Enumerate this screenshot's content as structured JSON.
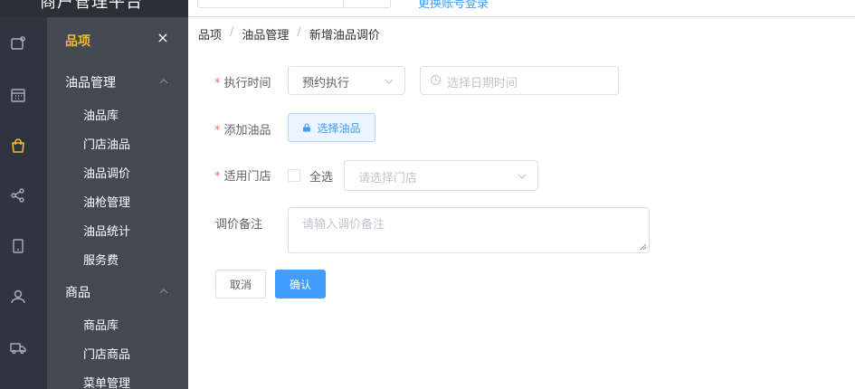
{
  "header": {
    "brand": "商户管理平台",
    "link": "更换账号登录"
  },
  "rail": {
    "icons": [
      "coupon-icon",
      "calendar-icon",
      "shopping-bag-icon",
      "share-icon",
      "tablet-icon",
      "user-icon",
      "truck-icon"
    ],
    "active_color": "#f7ba2a"
  },
  "menu": {
    "title": "品项",
    "close": "×",
    "groups": [
      {
        "label": "油品管理",
        "items": [
          "油品库",
          "门店油品",
          "油品调价",
          "油枪管理",
          "油品统计",
          "服务费"
        ]
      },
      {
        "label": "商品",
        "items": [
          "商品库",
          "门店商品",
          "菜单管理"
        ]
      }
    ]
  },
  "breadcrumb": {
    "items": [
      "品项",
      "油品管理",
      "新增油品调价"
    ],
    "sep": "/"
  },
  "form": {
    "required_mark": "*",
    "exec_time": {
      "label": "执行时间",
      "mode_value": "预约执行",
      "date_placeholder": "选择日期时间"
    },
    "add_oil": {
      "label": "添加油品",
      "button": "选择油品"
    },
    "stores": {
      "label": "适用门店",
      "select_all": "全选",
      "placeholder": "请选择门店"
    },
    "remark": {
      "label": "调价备注",
      "placeholder": "请输入调价备注"
    },
    "cancel": "取消",
    "confirm": "确认"
  },
  "colors": {
    "primary": "#409eff",
    "danger": "#f56c6c",
    "rail_bg": "#2f3540",
    "menu_bg": "#424953"
  }
}
